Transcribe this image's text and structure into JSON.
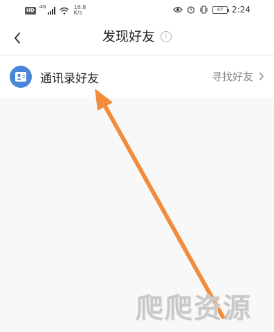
{
  "status_bar": {
    "hd": "HD",
    "net_type": "4G",
    "speed_value": "18.8",
    "speed_unit": "K/s",
    "battery": "47",
    "time": "2:24"
  },
  "header": {
    "title": "发现好友"
  },
  "contact_entry": {
    "label": "通讯录好友",
    "action": "寻找好友"
  },
  "watermark": {
    "text": "爬爬资源"
  },
  "colors": {
    "accent_icon": "#4a86d8",
    "annotation_arrow": "#f28c3c"
  }
}
